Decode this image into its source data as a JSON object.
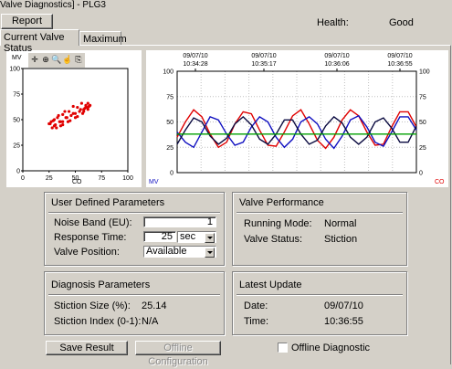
{
  "window": {
    "title": "Valve Diagnostics] - PLG3"
  },
  "toolbar": {
    "report_label": "Report",
    "health_label": "Health:",
    "health_value": "Good"
  },
  "tabs": [
    {
      "label": "Current Valve Status",
      "active": true
    },
    {
      "label": "Maximum",
      "active": false
    }
  ],
  "xy_plot": {
    "ylabel": "MV",
    "xlabel": "CO",
    "y_ticks": [
      "100",
      "75",
      "50",
      "25",
      "0"
    ],
    "x_ticks": [
      "0",
      "25",
      "50",
      "75",
      "100"
    ],
    "tool_icons": [
      "crosshair-icon",
      "zoom-region-icon",
      "zoom-in-icon",
      "pan-hand-icon",
      "copy-icon"
    ]
  },
  "chart_data": [
    {
      "type": "scatter",
      "xlabel": "CO",
      "ylabel": "MV",
      "xlim": [
        0,
        100
      ],
      "ylim": [
        0,
        100
      ],
      "series": [
        {
          "color": "#e00000",
          "points": [
            [
              25,
              46
            ],
            [
              28,
              42
            ],
            [
              32,
              42
            ],
            [
              38,
              45
            ],
            [
              45,
              49
            ],
            [
              52,
              53
            ],
            [
              58,
              58
            ],
            [
              62,
              62
            ],
            [
              64,
              64
            ],
            [
              62,
              66
            ],
            [
              56,
              66
            ],
            [
              48,
              63
            ],
            [
              40,
              58
            ],
            [
              34,
              54
            ],
            [
              30,
              50
            ],
            [
              27,
              48
            ],
            [
              26,
              46
            ],
            [
              30,
              44
            ],
            [
              36,
              44
            ],
            [
              43,
              48
            ],
            [
              50,
              52
            ],
            [
              57,
              56
            ],
            [
              62,
              60
            ],
            [
              63,
              63
            ],
            [
              60,
              64
            ],
            [
              52,
              62
            ],
            [
              44,
              58
            ],
            [
              38,
              55
            ],
            [
              33,
              52
            ],
            [
              29,
              49
            ],
            [
              31,
              45
            ],
            [
              35,
              48
            ],
            [
              41,
              52
            ],
            [
              48,
              56
            ],
            [
              55,
              60
            ],
            [
              60,
              62
            ],
            [
              58,
              60
            ],
            [
              50,
              56
            ],
            [
              42,
              52
            ],
            [
              36,
              48
            ],
            [
              38,
              48
            ],
            [
              46,
              54
            ],
            [
              54,
              58
            ],
            [
              59,
              61
            ]
          ]
        }
      ]
    },
    {
      "type": "line",
      "x_tick_labels": [
        [
          "09/07/10",
          "10:34:28"
        ],
        [
          "09/07/10",
          "10:35:17"
        ],
        [
          "09/07/10",
          "10:36:06"
        ],
        [
          "09/07/10",
          "10:36:55"
        ]
      ],
      "y_ticks": [
        "100",
        "75",
        "50",
        "25",
        "0"
      ],
      "ylim": [
        0,
        100
      ],
      "left_axis_label": "MV",
      "right_axis_label": "CO",
      "series": [
        {
          "color": "#e00000",
          "values": [
            35,
            50,
            62,
            55,
            38,
            25,
            30,
            48,
            60,
            58,
            42,
            27,
            26,
            40,
            56,
            62,
            48,
            32,
            24,
            35,
            52,
            62,
            56,
            40,
            27,
            28,
            45,
            60,
            60,
            45
          ]
        },
        {
          "color": "#1010c0",
          "values": [
            40,
            30,
            25,
            40,
            55,
            52,
            38,
            27,
            30,
            45,
            55,
            50,
            35,
            25,
            33,
            50,
            55,
            48,
            33,
            24,
            36,
            52,
            56,
            45,
            30,
            26,
            40,
            55,
            55,
            42
          ]
        },
        {
          "color": "#0a0a40",
          "values": [
            28,
            42,
            54,
            50,
            36,
            28,
            34,
            48,
            55,
            47,
            33,
            28,
            38,
            52,
            52,
            38,
            28,
            32,
            46,
            55,
            49,
            35,
            28,
            35,
            50,
            54,
            44,
            30,
            30,
            46
          ]
        },
        {
          "color": "#00a000",
          "values": [
            38,
            38,
            38,
            38,
            38,
            38,
            38,
            38,
            38,
            38,
            38,
            38,
            38,
            38,
            38,
            38,
            38,
            38,
            38,
            38,
            38,
            38,
            38,
            38,
            38,
            38,
            38,
            38,
            38,
            38
          ]
        }
      ]
    }
  ],
  "user_params": {
    "title": "User Defined Parameters",
    "noise_label": "Noise Band (EU):",
    "noise_value": "1",
    "response_label": "Response Time:",
    "response_value": "25",
    "response_unit": "sec",
    "position_label": "Valve Position:",
    "position_value": "Available"
  },
  "valve_perf": {
    "title": "Valve Performance",
    "mode_label": "Running Mode:",
    "mode_value": "Normal",
    "status_label": "Valve Status:",
    "status_value": "Stiction"
  },
  "diag_params": {
    "title": "Diagnosis Parameters",
    "size_label": "Stiction Size (%):",
    "size_value": "25.14",
    "index_label": "Stiction Index (0-1):",
    "index_value": "N/A"
  },
  "latest_update": {
    "title": "Latest Update",
    "date_label": "Date:",
    "date_value": "09/07/10",
    "time_label": "Time:",
    "time_value": "10:36:55"
  },
  "footer": {
    "save_label": "Save Result",
    "offline_config_label": "Offline Configuration",
    "offline_diag_label": "Offline Diagnostic",
    "offline_diag_checked": false
  }
}
